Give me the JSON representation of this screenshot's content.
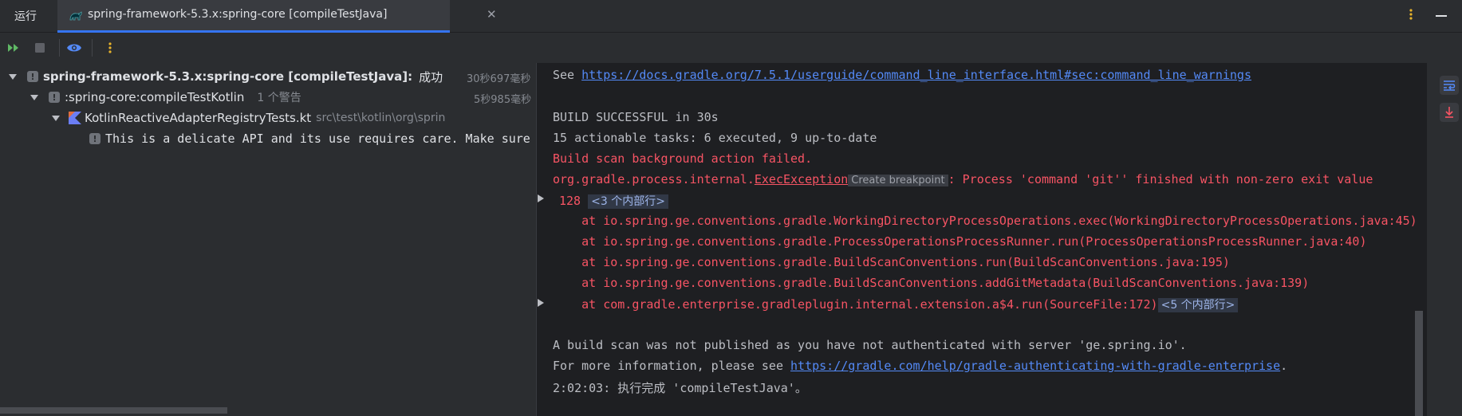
{
  "tabbar": {
    "run_label": "运行",
    "tab_title": "spring-framework-5.3.x:spring-core [compileTestJava]",
    "close_glyph": "✕"
  },
  "icons": {
    "rerun": "rerun-icon",
    "stop": "stop-icon",
    "show-passed": "eye-icon",
    "more": "more-vertical-icon",
    "minimize": "minimize-icon",
    "soft-wrap": "soft-wrap-icon",
    "scroll-to-end": "scroll-to-end-icon",
    "gradle": "gradle-icon",
    "kotlin": "kotlin-file-icon",
    "warning": "warning-icon"
  },
  "colors": {
    "accent": "#3574f0",
    "error": "#f75464",
    "link": "#548af7",
    "more_dots": "#e8b32b"
  },
  "tree": {
    "root": {
      "label": "spring-framework-5.3.x:spring-core [compileTestJava]:",
      "status": "成功",
      "time": "30秒697毫秒"
    },
    "task": {
      "label": ":spring-core:compileTestKotlin",
      "note": "1 个警告",
      "time": "5秒985毫秒"
    },
    "file": {
      "label": "KotlinReactiveAdapterRegistryTests.kt",
      "path": "src\\test\\kotlin\\org\\sprin"
    },
    "warning": {
      "label": "This is a delicate API and its use requires care. Make sure"
    }
  },
  "console": {
    "see_prefix": "See ",
    "see_link": "https://docs.gradle.org/7.5.1/userguide/command_line_interface.html#sec:command_line_warnings",
    "build_success": "BUILD SUCCESSFUL in 30s",
    "tasks": "15 actionable tasks: 6 executed, 9 up-to-date",
    "scan_failed": "Build scan background action failed.",
    "exception_prefix": "org.gradle.process.internal.",
    "exception_class": "ExecException",
    "create_breakpoint": "Create breakpoint",
    "exception_msg": ": Process 'command 'git'' finished with non-zero exit value",
    "exit_code": "128",
    "fold1": "<3 个内部行>",
    "stack": [
      "    at io.spring.ge.conventions.gradle.WorkingDirectoryProcessOperations.exec(WorkingDirectoryProcessOperations.java:45)",
      "    at io.spring.ge.conventions.gradle.ProcessOperationsProcessRunner.run(ProcessOperationsProcessRunner.java:40)",
      "    at io.spring.ge.conventions.gradle.BuildScanConventions.run(BuildScanConventions.java:195)",
      "    at io.spring.ge.conventions.gradle.BuildScanConventions.addGitMetadata(BuildScanConventions.java:139)",
      "    at com.gradle.enterprise.gradleplugin.internal.extension.a$4.run(SourceFile:172)"
    ],
    "fold2": "<5 个内部行>",
    "not_published": "A build scan was not published as you have not authenticated with server 'ge.spring.io'.",
    "more_info_prefix": "For more information, please see ",
    "more_info_link": "https://gradle.com/help/gradle-authenticating-with-gradle-enterprise",
    "more_info_suffix": ".",
    "finished": "2:02:03: 执行完成 'compileTestJava'。"
  }
}
